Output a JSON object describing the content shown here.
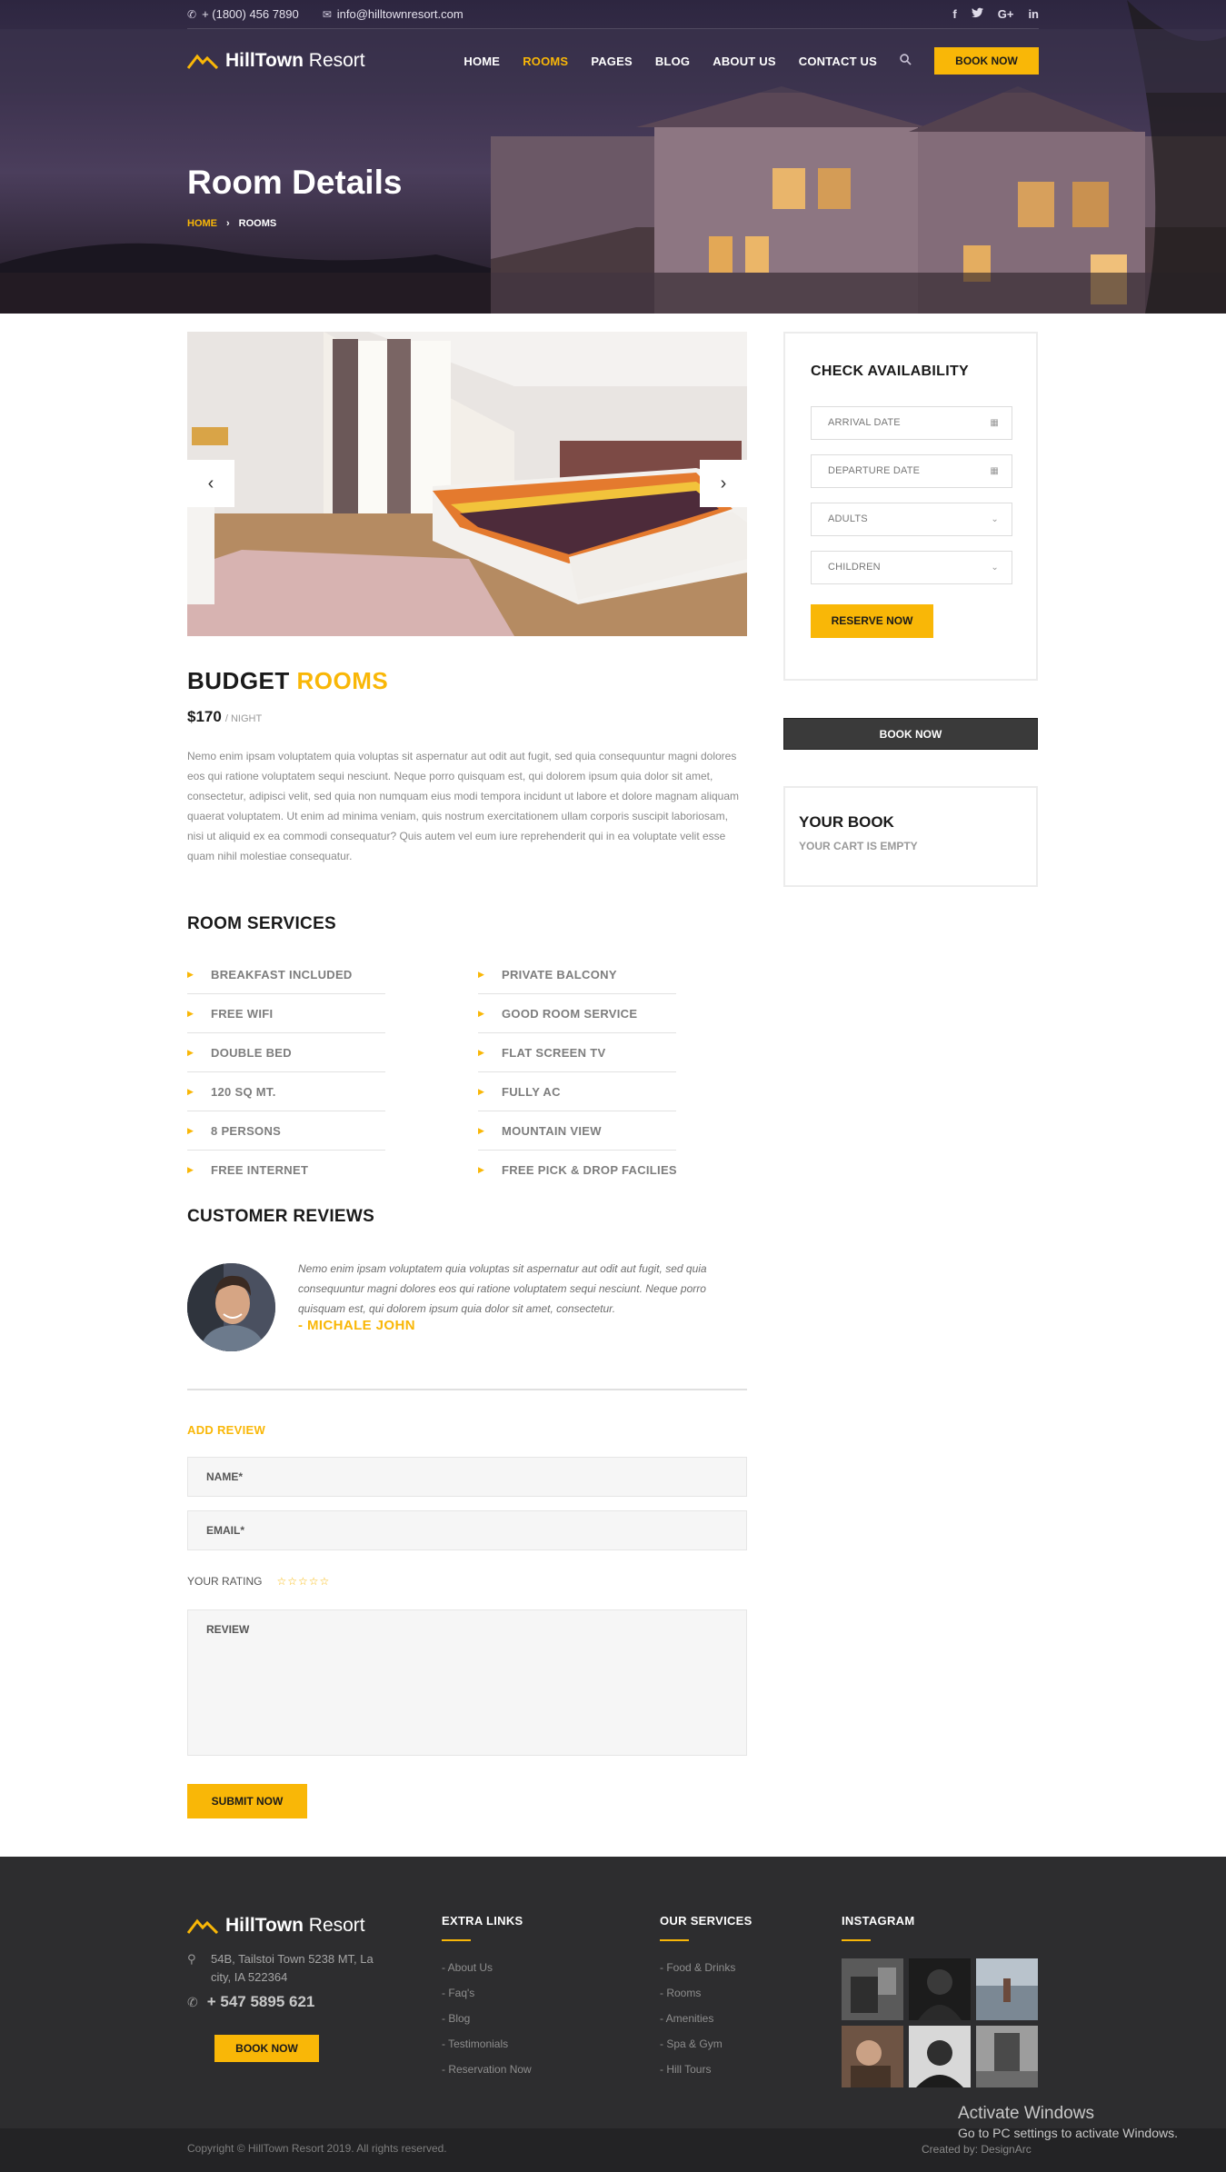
{
  "topbar": {
    "phone": "+ (1800) 456 7890",
    "email": "info@hilltownresort.com",
    "social": [
      "f",
      "🐦",
      "G+",
      "in"
    ]
  },
  "brand": {
    "name_bold": "HillTown",
    "name_light": " Resort"
  },
  "nav": {
    "items": [
      {
        "label": "HOME"
      },
      {
        "label": "ROOMS"
      },
      {
        "label": "PAGES"
      },
      {
        "label": "BLOG"
      },
      {
        "label": "ABOUT US"
      },
      {
        "label": "CONTACT US"
      }
    ],
    "active": "ROOMS",
    "book_label": "BOOK NOW"
  },
  "hero": {
    "title": "Room Details",
    "breadcrumb_home": "HOME",
    "breadcrumb_sep": "›",
    "breadcrumb_current": "ROOMS"
  },
  "room": {
    "title_main": "BUDGET ",
    "title_accent": "ROOMS",
    "price": "$170",
    "price_unit": "/ NIGHT",
    "description": "Nemo enim ipsam voluptatem quia voluptas sit aspernatur aut odit aut fugit, sed quia consequuntur magni dolores eos qui ratione voluptatem sequi nesciunt. Neque porro quisquam est, qui dolorem ipsum quia dolor sit amet, consectetur, adipisci velit, sed quia non numquam eius modi tempora incidunt ut labore et dolore magnam aliquam quaerat voluptatem. Ut enim ad minima veniam, quis nostrum exercitationem ullam corporis suscipit laboriosam, nisi ut aliquid ex ea commodi consequatur? Quis autem vel eum iure reprehenderit qui in ea voluptate velit esse quam nihil molestiae consequatur."
  },
  "services": {
    "title": "ROOM SERVICES",
    "left": [
      "BREAKFAST INCLUDED",
      "FREE WIFI",
      "DOUBLE BED",
      "120 SQ MT.",
      "8 PERSONS",
      "FREE INTERNET"
    ],
    "right": [
      "PRIVATE BALCONY",
      "GOOD ROOM SERVICE",
      "FLAT SCREEN TV",
      "FULLY AC",
      "MOUNTAIN VIEW",
      "FREE PICK & DROP FACILIES"
    ]
  },
  "reviews": {
    "title": "CUSTOMER REVIEWS",
    "text": "Nemo enim ipsam voluptatem quia voluptas sit aspernatur aut odit aut fugit, sed quia consequuntur magni dolores eos qui ratione voluptatem sequi nesciunt. Neque porro quisquam est, qui dolorem ipsum quia dolor sit amet, consectetur.",
    "author": "- MICHALE JOHN"
  },
  "add_review": {
    "title": "ADD REVIEW",
    "name_placeholder": "NAME*",
    "email_placeholder": "EMAIL*",
    "rating_label": "YOUR RATING",
    "stars": "☆☆☆☆☆",
    "review_placeholder": "REVIEW",
    "submit_label": "SUBMIT NOW"
  },
  "availability": {
    "title": "CHECK AVAILABILITY",
    "arrival": "ARRIVAL DATE",
    "departure": "DEPARTURE DATE",
    "adults": "ADULTS",
    "children": "CHILDREN",
    "reserve_label": "RESERVE NOW"
  },
  "sidebar": {
    "book_label": "BOOK NOW",
    "your_book_title": "YOUR BOOK",
    "your_book_status": "YOUR CART IS EMPTY"
  },
  "footer": {
    "address": "54B, Tailstoi Town 5238 MT, La city, IA 522364",
    "phone": "+ 547 5895 621",
    "book_label": "BOOK NOW",
    "extra_links_title": "EXTRA LINKS",
    "extra_links": [
      "- About Us",
      "- Faq's",
      "- Blog",
      "- Testimonials",
      "- Reservation Now"
    ],
    "services_title": "OUR SERVICES",
    "services": [
      "- Food & Drinks",
      "- Rooms",
      "- Amenities",
      "- Spa & Gym",
      "- Hill Tours"
    ],
    "instagram_title": "INSTAGRAM",
    "copyright": "Copyright © HillTown Resort 2019. All rights reserved.",
    "created_by": "Created by: DesignArc"
  },
  "windows": {
    "activate_title": "Activate Windows",
    "activate_sub": "Go to PC settings to activate Windows."
  },
  "colors": {
    "accent": "#f9b707",
    "dark": "#2d2d2f",
    "text_muted": "#8a8a8a"
  },
  "icons": [
    "phone-icon",
    "envelope-icon",
    "facebook-icon",
    "twitter-icon",
    "google-plus-icon",
    "linkedin-icon",
    "search-icon",
    "mountain-logo-icon",
    "chevron-left-icon",
    "chevron-right-icon",
    "calendar-icon",
    "chevron-down-icon",
    "map-pin-icon",
    "star-icon"
  ]
}
